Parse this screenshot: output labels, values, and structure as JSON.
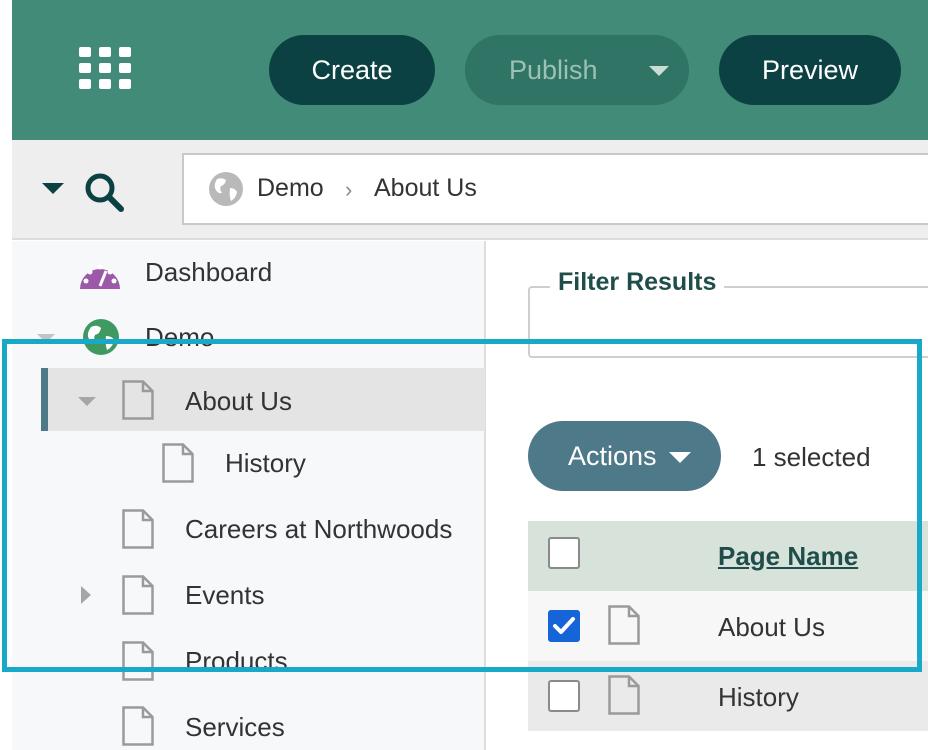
{
  "toolbar": {
    "apps_icon": "grid-icon",
    "create_label": "Create",
    "publish_label": "Publish",
    "preview_label": "Preview"
  },
  "addressbar": {
    "breadcrumb": [
      "Demo",
      "About Us"
    ],
    "separator": "›",
    "site_icon": "globe-icon"
  },
  "sidebar": {
    "dashboard": {
      "label": "Dashboard",
      "icon": "dashboard-gauge-icon"
    },
    "site": {
      "label": "Demo",
      "icon": "globe-icon"
    },
    "items": [
      {
        "label": "About Us",
        "icon": "page-icon",
        "expanded": true,
        "selected": true
      },
      {
        "label": "History",
        "icon": "page-icon",
        "child": true
      },
      {
        "label": "Careers at Northwoods",
        "icon": "page-icon"
      },
      {
        "label": "Events",
        "icon": "page-icon",
        "collapsed": true
      },
      {
        "label": "Products",
        "icon": "page-icon"
      },
      {
        "label": "Services",
        "icon": "page-icon"
      }
    ]
  },
  "main": {
    "filter_legend": "Filter Results",
    "actions_label": "Actions",
    "selected_count": "1 selected",
    "table": {
      "column_header": "Page Name",
      "rows": [
        {
          "name": "About Us",
          "checked": true
        },
        {
          "name": "History",
          "checked": false
        }
      ]
    }
  },
  "colors": {
    "topbar": "#428b78",
    "dark_button": "#0c4143",
    "accent": "#4e7989",
    "highlight": "#18a9c9",
    "checkbox_checked": "#1565d8"
  }
}
